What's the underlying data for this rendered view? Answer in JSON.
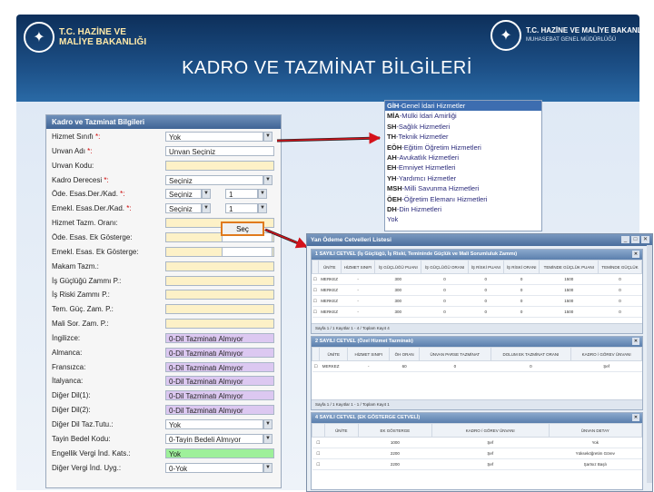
{
  "header": {
    "left_logo_lines": [
      "T.C. HAZİNE VE",
      "MALİYE BAKANLIĞI"
    ],
    "right_logo_title": "T.C. HAZİNE VE MALİYE BAKANLIĞI",
    "right_logo_sub": "MUHASEBAT GENEL MÜDÜRLÜĞÜ",
    "slide_title": "KADRO VE TAZMİNAT BİLGİLERİ"
  },
  "form": {
    "title": "Kadro ve Tazminat Bilgileri",
    "rows": [
      {
        "label": "Hizmet Sınıfı",
        "required": true,
        "value": "Yok",
        "style": "white",
        "dropdown": true
      },
      {
        "label": "Unvan Adı",
        "required": true,
        "value": "Unvan Seçiniz",
        "style": "white",
        "dropdown": false
      },
      {
        "label": "Unvan Kodu:",
        "required": false,
        "value": "",
        "style": "yellow",
        "dropdown": false
      },
      {
        "label": "Kadro Derecesi",
        "required": true,
        "value": "Seçiniz",
        "style": "white",
        "dropdown": true
      },
      {
        "label": "Öde. Esas.Der./Kad.",
        "required": true,
        "value": "Seçiniz",
        "value2": "1",
        "style": "white",
        "dropdown": true
      },
      {
        "label": "Emekl. Esas.Der./Kad.",
        "required": true,
        "value": "Seçiniz",
        "value2": "1",
        "style": "white",
        "dropdown": true
      },
      {
        "label": "Hizmet Tazm. Oranı:",
        "required": false,
        "value": "",
        "style": "yellow",
        "dropdown": false
      },
      {
        "label": "Öde. Esas. Ek Gösterge:",
        "required": false,
        "value": "",
        "style": "yellow",
        "dropdown": false
      },
      {
        "label": "Emekl. Esas. Ek Gösterge:",
        "required": false,
        "value": "",
        "style": "yellow",
        "dropdown": false
      },
      {
        "label": "Makam Tazm.:",
        "required": false,
        "value": "",
        "style": "yellow",
        "dropdown": false
      },
      {
        "label": "İş Güçlüğü Zammı P.:",
        "required": false,
        "value": "",
        "style": "yellow",
        "dropdown": false
      },
      {
        "label": "İş Riski Zammı P.:",
        "required": false,
        "value": "",
        "style": "yellow",
        "dropdown": false
      },
      {
        "label": "Tem. Güç. Zam. P.:",
        "required": false,
        "value": "",
        "style": "yellow",
        "dropdown": false
      },
      {
        "label": "Mali Sor. Zam. P.:",
        "required": false,
        "value": "",
        "style": "yellow",
        "dropdown": false
      },
      {
        "label": "İngilizce:",
        "required": false,
        "value": "0-Dil Tazminatı Almıyor",
        "style": "purple",
        "dropdown": false
      },
      {
        "label": "Almanca:",
        "required": false,
        "value": "0-Dil Tazminatı Almıyor",
        "style": "purple",
        "dropdown": false
      },
      {
        "label": "Fransızca:",
        "required": false,
        "value": "0-Dil Tazminatı Almıyor",
        "style": "purple",
        "dropdown": false
      },
      {
        "label": "İtalyanca:",
        "required": false,
        "value": "0-Dil Tazminatı Almıyor",
        "style": "purple",
        "dropdown": false
      },
      {
        "label": "Diğer Dil(1):",
        "required": false,
        "value": "0-Dil Tazminatı Almıyor",
        "style": "purple",
        "dropdown": false
      },
      {
        "label": "Diğer Dil(2):",
        "required": false,
        "value": "0-Dil Tazminatı Almıyor",
        "style": "purple",
        "dropdown": false
      },
      {
        "label": "Diğer Dil Taz.Tutu.:",
        "required": false,
        "value": "Yok",
        "style": "white",
        "dropdown": true
      },
      {
        "label": "Tayin Bedel Kodu:",
        "required": false,
        "value": "0-Tayin Bedeli Almıyor",
        "style": "white",
        "dropdown": true
      },
      {
        "label": "Engellik Vergi İnd. Kats.:",
        "required": false,
        "value": "Yok",
        "style": "green",
        "dropdown": false
      },
      {
        "label": "Diğer Vergi İnd. Uyg.:",
        "required": false,
        "value": "0-Yok",
        "style": "white",
        "dropdown": true
      }
    ],
    "required_mark": "*:",
    "search_button": "Seç"
  },
  "dropdown_list": [
    {
      "code": "GİH",
      "text": "-Genel İdari Hizmetler",
      "selected": true
    },
    {
      "code": "MİA",
      "text": "-Mülki İdari Amirliği",
      "selected": false
    },
    {
      "code": "SH",
      "text": "-Sağlık Hizmetleri",
      "selected": false
    },
    {
      "code": "TH",
      "text": "-Teknik Hizmetler",
      "selected": false
    },
    {
      "code": "EÖH",
      "text": "-Eğitim Öğretim Hizmetleri",
      "selected": false
    },
    {
      "code": "AH",
      "text": "-Avukatlık Hizmetleri",
      "selected": false
    },
    {
      "code": "EH",
      "text": "-Emniyet Hizmetleri",
      "selected": false
    },
    {
      "code": "YH",
      "text": "-Yardımcı Hizmetler",
      "selected": false
    },
    {
      "code": "MSH",
      "text": "-Milli Savunma Hizmetleri",
      "selected": false
    },
    {
      "code": "ÖEH",
      "text": "-Öğretim Elemanı Hizmetleri",
      "selected": false
    },
    {
      "code": "DH",
      "text": "-Din Hizmetleri",
      "selected": false
    },
    {
      "code": "",
      "text": "Yok",
      "selected": false
    }
  ],
  "window": {
    "title": "Yan Ödeme Cetvelleri Listesi",
    "panels": [
      {
        "head": "1 SAYILI CETVEL (İş Güçlüğü, İş Riski, Temininde Güçlük ve Mali Sorumluluk Zammı)",
        "columns": [
          "ÜNİTE",
          "HİZMET SINIFI",
          "İŞ GÜÇLÜĞÜ PUANI",
          "İŞ GÜÇLÜĞÜ ORANI",
          "İŞ RİSKİ PUANI",
          "İŞ RİSKİ ORANI",
          "TEMİNDE GÜÇLÜK PUANI",
          "TEMİNDE GÜÇLÜK"
        ],
        "rows": [
          [
            "MERKEZ",
            "-",
            "300",
            "0",
            "0",
            "0",
            "1500",
            "0"
          ],
          [
            "MERKEZ",
            "-",
            "300",
            "0",
            "0",
            "0",
            "1500",
            "0"
          ],
          [
            "MERKEZ",
            "-",
            "300",
            "0",
            "0",
            "0",
            "1500",
            "0"
          ],
          [
            "MERKEZ",
            "-",
            "300",
            "0",
            "0",
            "0",
            "1500",
            "0"
          ]
        ],
        "pager": "Sayfa 1 / 1   Kayıtlar 1 - 4 / Toplam Kayıt 4"
      },
      {
        "head": "2 SAYILI CETVEL (Özel Hizmet Tazminatı)",
        "columns": [
          "ÜNİTE",
          "HİZMET SINIFI",
          "ÖH ORAN",
          "ÜNVAN PARSE TAZMİNAT",
          "DOLUM EK TAZMİNAT ORANI",
          "KADRO / GÖREV ÜNVANI"
        ],
        "rows": [
          [
            "MERKEZ",
            "-",
            "60",
            "0",
            "0",
            "Şef"
          ]
        ],
        "pager": "Sayfa 1 / 1   Kayıtlar 1 - 1 / Toplam Kayıt 1"
      },
      {
        "head": "4 SAYILI CETVEL (EK GÖSTERGE CETVELİ)",
        "columns": [
          "ÜNİTE",
          "EK GÖSTERGE",
          "KADRO / GÖREV ÜNVANI",
          "ÜNVAN DETAY"
        ],
        "rows": [
          [
            "",
            "1000",
            "Şef",
            "Yok"
          ],
          [
            "",
            "2200",
            "Şef",
            "Yükseköğretim Görev"
          ],
          [
            "",
            "2200",
            "Şef",
            "Şartsız Başlı"
          ]
        ]
      }
    ]
  }
}
